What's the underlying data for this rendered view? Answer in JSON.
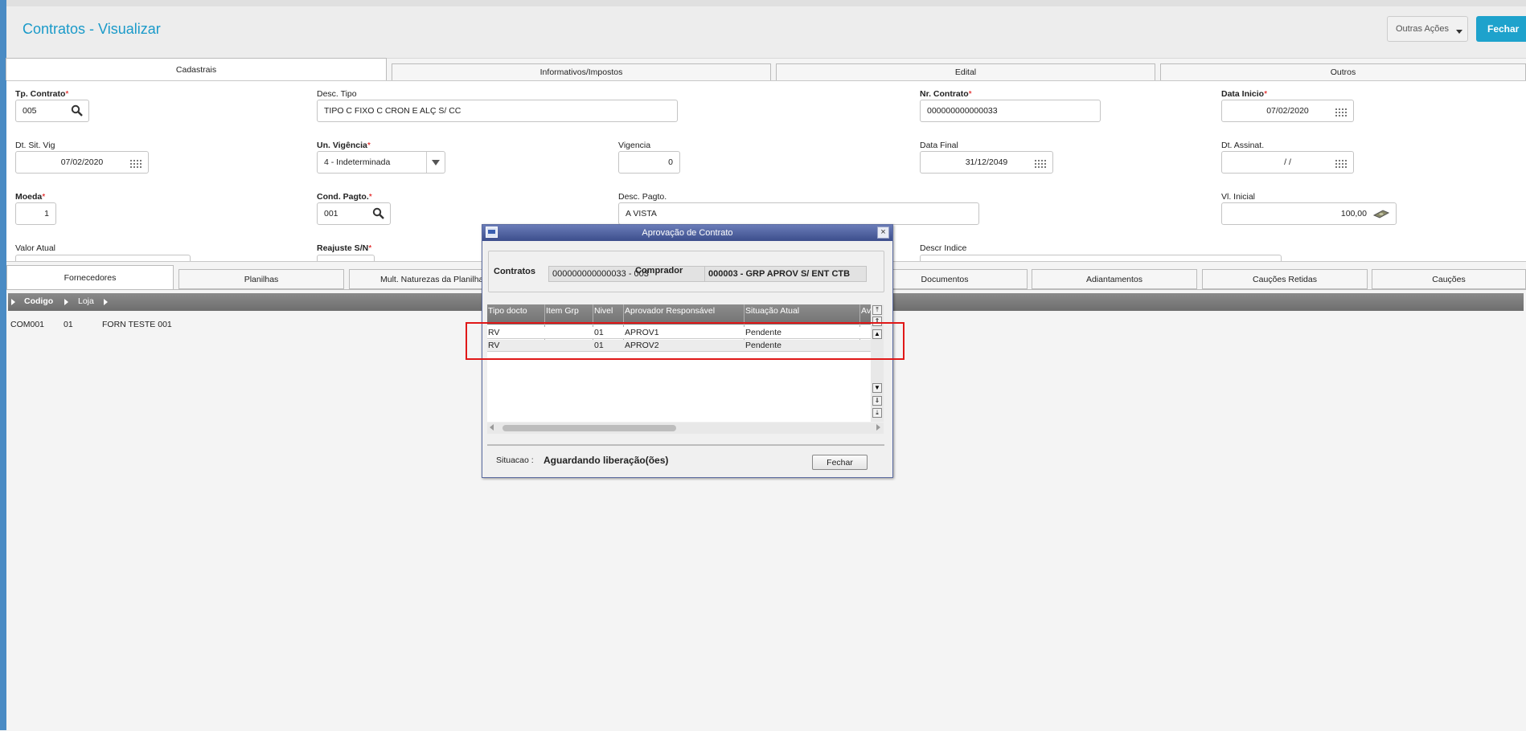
{
  "page": {
    "title": "Contratos - Visualizar"
  },
  "header": {
    "outras_acoes": "Outras Ações",
    "fechar": "Fechar"
  },
  "tabs": [
    "Cadastrais",
    "Informativos/Impostos",
    "Edital",
    "Outros"
  ],
  "form": {
    "tp_contrato": {
      "label": "Tp. Contrato",
      "value": "005"
    },
    "desc_tipo": {
      "label": "Desc. Tipo",
      "value": "TIPO C FIXO C CRON E ALÇ S/ CC"
    },
    "nr_contrato": {
      "label": "Nr. Contrato",
      "value": "000000000000033"
    },
    "data_inicio": {
      "label": "Data Inicio",
      "value": "07/02/2020"
    },
    "dt_sit_vig": {
      "label": "Dt. Sit. Vig",
      "value": "07/02/2020"
    },
    "un_vigencia": {
      "label": "Un. Vigência",
      "value": "4 - Indeterminada"
    },
    "vigencia": {
      "label": "Vigencia",
      "value": "0"
    },
    "data_final": {
      "label": "Data Final",
      "value": "31/12/2049"
    },
    "dt_assinat": {
      "label": "Dt. Assinat.",
      "value": "/ /"
    },
    "moeda": {
      "label": "Moeda",
      "value": "1"
    },
    "cond_pagto": {
      "label": "Cond. Pagto.",
      "value": "001"
    },
    "desc_pagto": {
      "label": "Desc. Pagto.",
      "value": "A VISTA"
    },
    "vl_inicial": {
      "label": "Vl. Inicial",
      "value": "100,00"
    },
    "valor_atual": {
      "label": "Valor Atual"
    },
    "reajuste": {
      "label": "Reajuste S/N"
    },
    "descr_indice": {
      "label": "Descr Indice"
    }
  },
  "bottom_tabs": [
    "Fornecedores",
    "Planilhas",
    "Mult. Naturezas da Planilha",
    "Documentos",
    "Adiantamentos",
    "Cauções Retidas",
    "Cauções"
  ],
  "grid": {
    "columns": [
      "Codigo",
      "Loja"
    ],
    "rows": [
      {
        "codigo": "COM001",
        "loja": "01",
        "nome": "FORN TESTE 001"
      }
    ]
  },
  "dialog": {
    "title": "Aprovação de Contrato",
    "contratos_label": "Contratos",
    "contratos_value": "000000000000033 - 003",
    "comprador_label": "Comprador",
    "comprador_value": "000003 - GRP APROV S/ ENT CTB",
    "columns": [
      "Tipo docto",
      "Item Grp",
      "Nivel",
      "Aprovador Responsável",
      "Situação Atual",
      "Av"
    ],
    "rows": [
      {
        "tipo": "RV",
        "item": "",
        "nivel": "01",
        "aprovador": "APROV1",
        "situacao": "Pendente"
      },
      {
        "tipo": "RV",
        "item": "",
        "nivel": "01",
        "aprovador": "APROV2",
        "situacao": "Pendente"
      }
    ],
    "situacao_label": "Situacao :",
    "situacao_value": "Aguardando liberação(ões)",
    "fechar": "Fechar"
  },
  "colors": {
    "accent": "#1ea2cc",
    "title": "#1a9ac9",
    "highlight": "#e01818",
    "dialog_title": "#3c4e8c"
  }
}
